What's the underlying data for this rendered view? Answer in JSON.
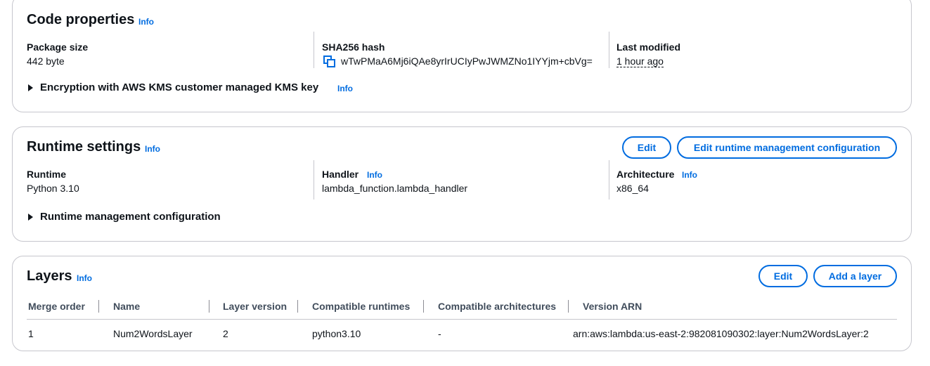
{
  "code_properties": {
    "title": "Code properties",
    "info": "Info",
    "package_size": {
      "label": "Package size",
      "value": "442 byte"
    },
    "sha256": {
      "label": "SHA256 hash",
      "value": "wTwPMaA6Mj6iQAe8yrIrUCIyPwJWMZNo1IYYjm+cbVg="
    },
    "last_modified": {
      "label": "Last modified",
      "value": "1 hour ago"
    },
    "encryption": {
      "label": "Encryption with AWS KMS customer managed KMS key",
      "info": "Info"
    }
  },
  "runtime_settings": {
    "title": "Runtime settings",
    "info": "Info",
    "edit_button": "Edit",
    "edit_runtime_button": "Edit runtime management configuration",
    "runtime": {
      "label": "Runtime",
      "value": "Python 3.10"
    },
    "handler": {
      "label": "Handler",
      "info": "Info",
      "value": "lambda_function.lambda_handler"
    },
    "architecture": {
      "label": "Architecture",
      "info": "Info",
      "value": "x86_64"
    },
    "runtime_mgmt": {
      "label": "Runtime management configuration"
    }
  },
  "layers": {
    "title": "Layers",
    "info": "Info",
    "edit_button": "Edit",
    "add_button": "Add a layer",
    "columns": [
      "Merge order",
      "Name",
      "Layer version",
      "Compatible runtimes",
      "Compatible architectures",
      "Version ARN"
    ],
    "rows": [
      [
        "1",
        "Num2WordsLayer",
        "2",
        "python3.10",
        "-",
        "arn:aws:lambda:us-east-2:982081090302:layer:Num2WordsLayer:2"
      ]
    ]
  },
  "colors": {
    "accent": "#006ce0",
    "border": "#c6c6cd",
    "text": "#0f141a"
  },
  "icons": {
    "copy": "copy-icon",
    "expand": "caret-right-icon"
  }
}
